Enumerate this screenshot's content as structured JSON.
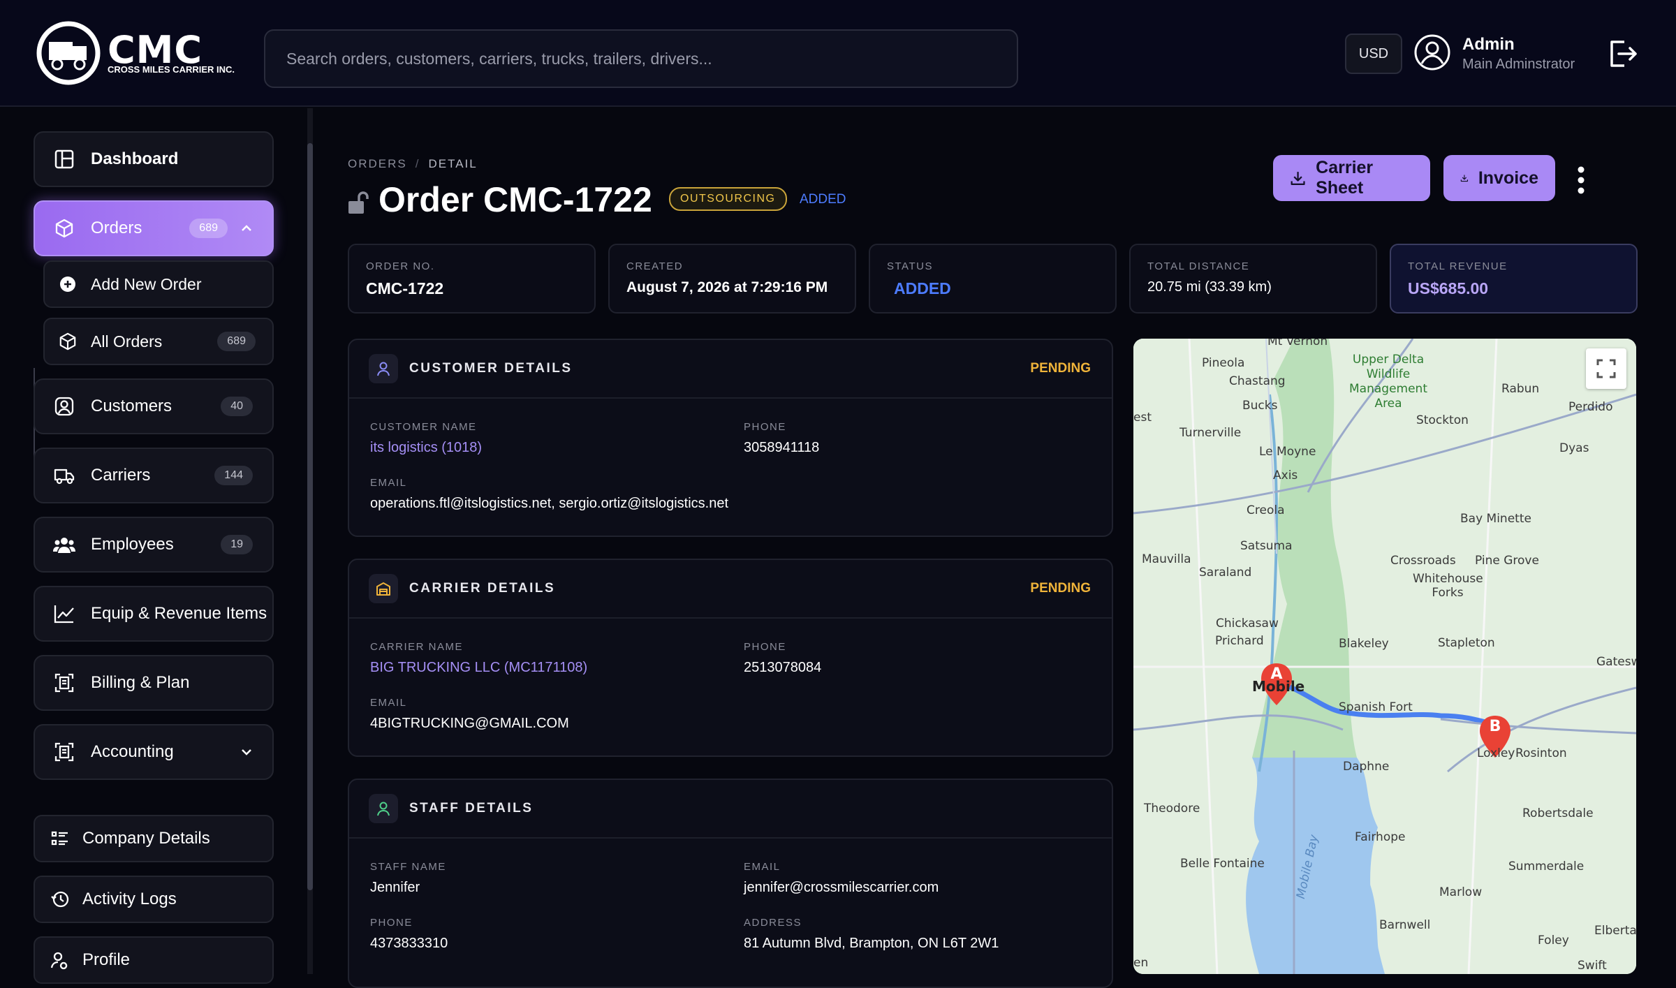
{
  "brand": {
    "name": "CMC",
    "tagline": "CROSS MILES CARRIER INC."
  },
  "search": {
    "placeholder": "Search orders, customers, carriers, trucks, trailers, drivers..."
  },
  "currency": "USD",
  "user": {
    "name": "Admin",
    "role": "Main Adminstrator"
  },
  "sidebar": {
    "dashboard": "Dashboard",
    "orders": {
      "label": "Orders",
      "count": "689"
    },
    "add_new_order": "Add New Order",
    "all_orders": {
      "label": "All Orders",
      "count": "689"
    },
    "customers": {
      "label": "Customers",
      "count": "40"
    },
    "carriers": {
      "label": "Carriers",
      "count": "144"
    },
    "employees": {
      "label": "Employees",
      "count": "19"
    },
    "equip": "Equip & Revenue Items",
    "billing": "Billing & Plan",
    "accounting": "Accounting",
    "company": "Company Details",
    "activity": "Activity Logs",
    "profile": "Profile"
  },
  "breadcrumb": {
    "root": "ORDERS",
    "sep": "/",
    "current": "DETAIL"
  },
  "order": {
    "title": "Order CMC-1722",
    "tag": "OUTSOURCING",
    "status_tag": "ADDED"
  },
  "actions": {
    "carrier_sheet": "Carrier Sheet",
    "invoice": "Invoice"
  },
  "stats": [
    {
      "label": "ORDER NO.",
      "value": "CMC-1722"
    },
    {
      "label": "CREATED",
      "value": "August 7, 2026 at 7:29:16 PM"
    },
    {
      "label": "STATUS",
      "value": "ADDED"
    },
    {
      "label": "TOTAL DISTANCE",
      "value": "20.75 mi (33.39 km)"
    },
    {
      "label": "TOTAL REVENUE",
      "value": "US$685.00"
    }
  ],
  "customer": {
    "title": "CUSTOMER DETAILS",
    "status": "PENDING",
    "name_label": "CUSTOMER NAME",
    "name": "its logistics (1018)",
    "phone_label": "PHONE",
    "phone": "3058941118",
    "email_label": "EMAIL",
    "email": "operations.ftl@itslogistics.net, sergio.ortiz@itslogistics.net"
  },
  "carrier": {
    "title": "CARRIER DETAILS",
    "status": "PENDING",
    "name_label": "CARRIER NAME",
    "name": "BIG TRUCKING LLC (MC1171108)",
    "phone_label": "PHONE",
    "phone": "2513078084",
    "email_label": "EMAIL",
    "email": "4BIGTRUCKING@GMAIL.COM"
  },
  "staff": {
    "title": "STAFF DETAILS",
    "name_label": "STAFF NAME",
    "name": "Jennifer",
    "email_label": "EMAIL",
    "email": "jennifer@crossmilescarrier.com",
    "phone_label": "PHONE",
    "phone": "4373833310",
    "address_label": "ADDRESS",
    "address": "81 Autumn Blvd, Brampton, ON L6T 2W1"
  },
  "map": {
    "labels": [
      "Mt Vernon",
      "Pineola",
      "Chastang",
      "Bucks",
      "Upper Delta Wildlife Management Area",
      "Rabun",
      "Perdido",
      "est",
      "Turnerville",
      "Le Moyne",
      "Stockton",
      "Dyas",
      "Axis",
      "Creola",
      "Bay Minette",
      "Mauvilla",
      "Satsuma",
      "Saraland",
      "Crossroads",
      "Pine Grove",
      "Whitehouse Forks",
      "Chickasaw",
      "Prichard",
      "Blakeley",
      "Stapleton",
      "Gateswo",
      "Mobile",
      "Spanish Fort",
      "Daphne",
      "Loxley",
      "Rosinton",
      "Theodore",
      "Robertsdale",
      "Fairhope",
      "Belle Fontaine",
      "Mobile Bay",
      "Summerdale",
      "Marlow",
      "Barnwell",
      "Foley",
      "Elberta",
      "Swift",
      "en"
    ],
    "marker_a": "A",
    "marker_b": "B"
  }
}
